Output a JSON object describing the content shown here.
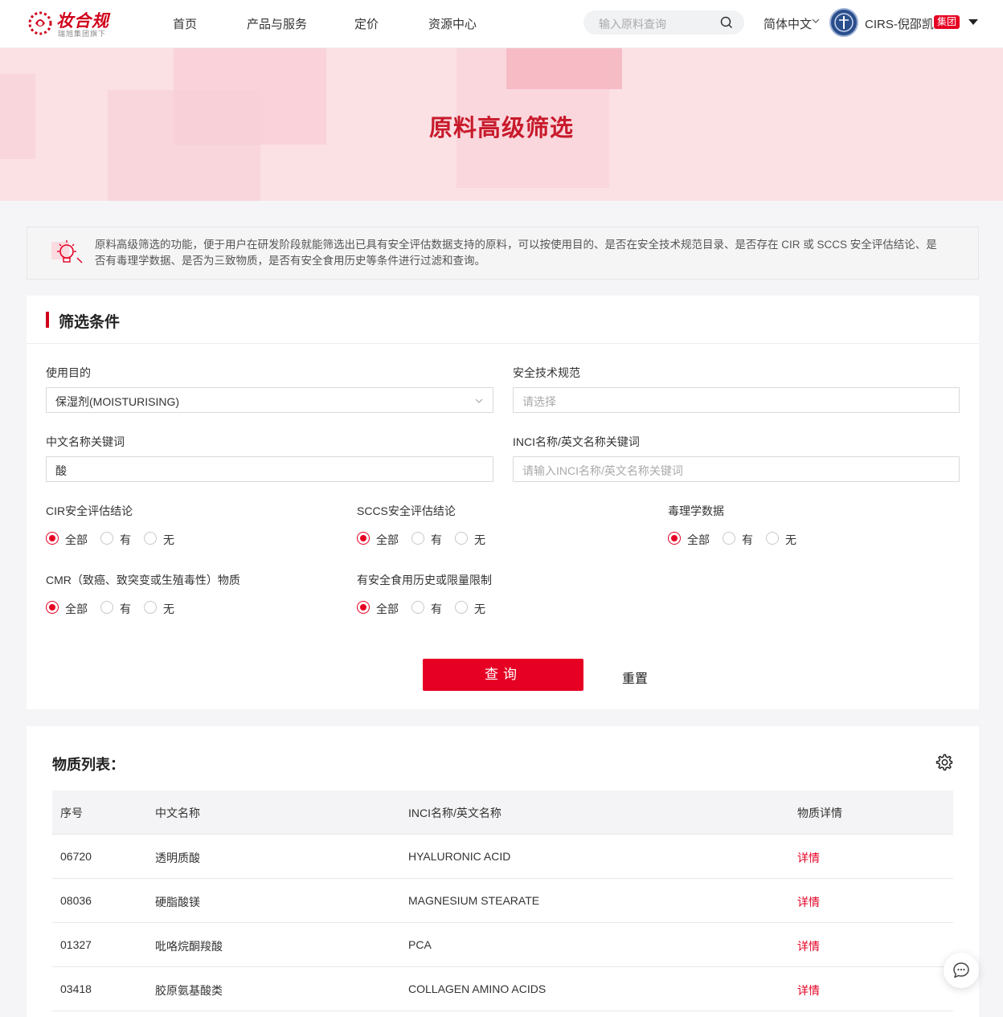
{
  "header": {
    "logo_text": "妆合规",
    "logo_sub": "瑞旭集团旗下",
    "nav": [
      "首页",
      "产品与服务",
      "定价",
      "资源中心"
    ],
    "search_placeholder": "输入原料查询",
    "language": "简体中文",
    "user_name": "CIRS-倪邵凯",
    "user_badge": "集团"
  },
  "hero": {
    "title": "原料高级筛选"
  },
  "notice": {
    "text": "原料高级筛选的功能，便于用户在研发阶段就能筛选出已具有安全评估数据支持的原料，可以按使用目的、是否在安全技术规范目录、是否存在 CIR 或 SCCS 安全评估结论、是否有毒理学数据、是否为三致物质，是否有安全食用历史等条件进行过滤和查询。"
  },
  "filter": {
    "title": "筛选条件",
    "purpose": {
      "label": "使用目的",
      "value": "保湿剂(MOISTURISING)"
    },
    "safety_standard": {
      "label": "安全技术规范",
      "placeholder": "请选择"
    },
    "cn_keyword": {
      "label": "中文名称关键词",
      "value": "酸"
    },
    "inci_keyword": {
      "label": "INCI名称/英文名称关键词",
      "placeholder": "请输入INCI名称/英文名称关键词"
    },
    "radio_options": [
      "全部",
      "有",
      "无"
    ],
    "cir": {
      "label": "CIR安全评估结论",
      "selected": "全部"
    },
    "sccs": {
      "label": "SCCS安全评估结论",
      "selected": "全部"
    },
    "tox": {
      "label": "毒理学数据",
      "selected": "全部"
    },
    "cmr": {
      "label": "CMR（致癌、致突变或生殖毒性）物质",
      "selected": "全部"
    },
    "food": {
      "label": "有安全食用历史或限量限制",
      "selected": "全部"
    },
    "query_label": "查询",
    "reset_label": "重置"
  },
  "results": {
    "title": "物质列表：",
    "columns": [
      "序号",
      "中文名称",
      "INCI名称/英文名称",
      "物质详情"
    ],
    "rows": [
      {
        "id": "06720",
        "cn": "透明质酸",
        "inci": "HYALURONIC ACID",
        "detail": "详情"
      },
      {
        "id": "08036",
        "cn": "硬脂酸镁",
        "inci": "MAGNESIUM STEARATE",
        "detail": "详情"
      },
      {
        "id": "01327",
        "cn": "吡咯烷酮羧酸",
        "inci": "PCA",
        "detail": "详情"
      },
      {
        "id": "03418",
        "cn": "胶原氨基酸类",
        "inci": "COLLAGEN AMINO ACIDS",
        "detail": "详情"
      }
    ]
  },
  "colors": {
    "brand_red": "#e60023",
    "title_red": "#c81a2b",
    "hero_bg": "#fbe0e4"
  }
}
